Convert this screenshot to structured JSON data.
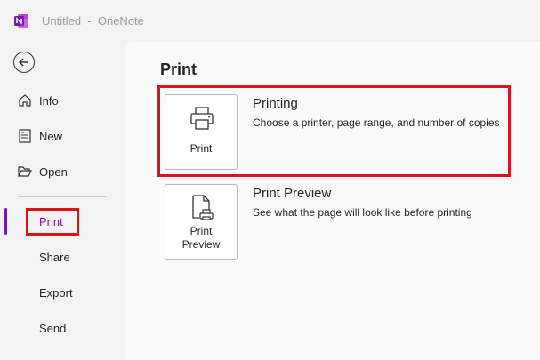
{
  "window": {
    "title": "Untitled  -  OneNote",
    "app_logo_icon": "onenote-logo-icon",
    "accent": "#7719aa"
  },
  "sidebar": {
    "back_icon": "back-arrow-icon",
    "items": [
      {
        "label": "Info",
        "icon": "home-icon"
      },
      {
        "label": "New",
        "icon": "new-page-icon"
      },
      {
        "label": "Open",
        "icon": "folder-open-icon"
      },
      {
        "label": "Print",
        "active": true
      },
      {
        "label": "Share"
      },
      {
        "label": "Export"
      },
      {
        "label": "Send"
      }
    ]
  },
  "main": {
    "title": "Print",
    "options": [
      {
        "button_label": "Print",
        "icon": "printer-icon",
        "title": "Printing",
        "description": "Choose a printer, page range, and number of copies"
      },
      {
        "button_label": "Print\nPreview",
        "icon": "print-preview-icon",
        "title": "Print Preview",
        "description": "See what the page will look like before printing"
      }
    ]
  },
  "highlight_color": "#d9141c"
}
